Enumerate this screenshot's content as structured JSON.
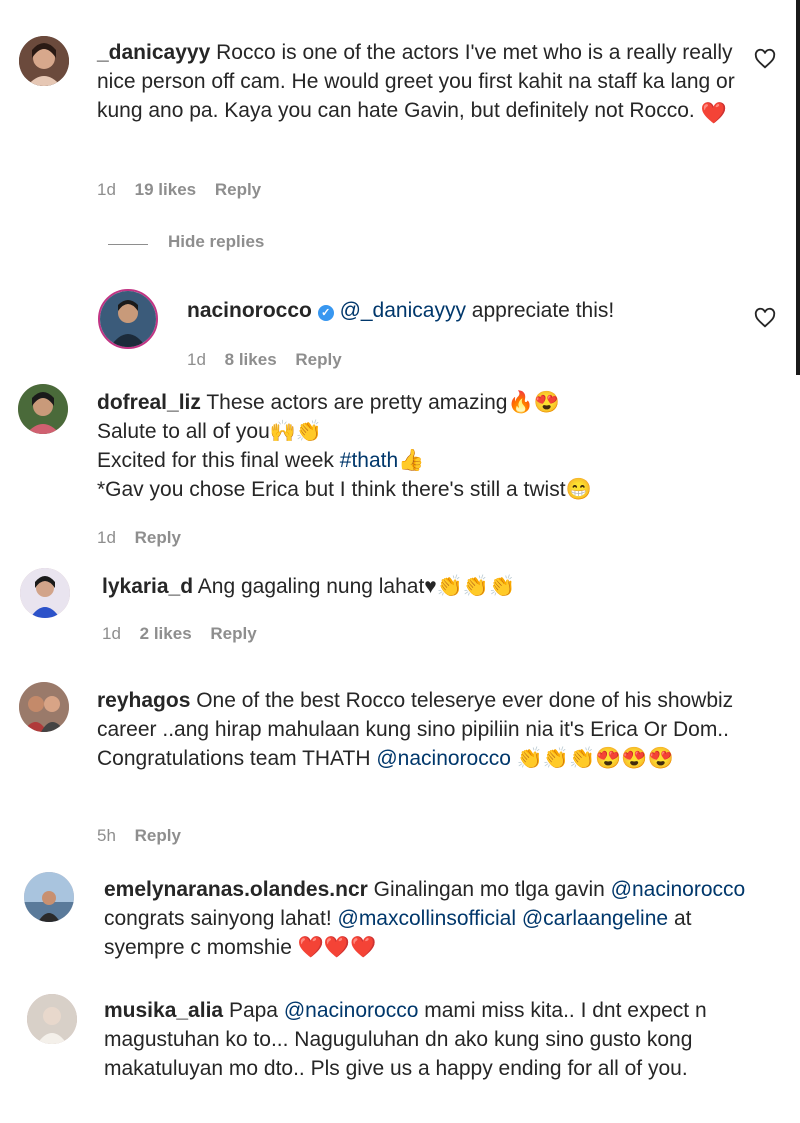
{
  "comments": [
    {
      "username": "_danicayyy",
      "text": "Rocco is one of the actors I've met who is a really really nice person off cam. He would greet you first kahit na staff ka lang or kung ano pa. Kaya you can hate Gavin, but definitely not Rocco.",
      "emoji": "❤️",
      "time": "1d",
      "likes": "19 likes",
      "reply": "Reply"
    },
    {
      "username": "nacinorocco",
      "mention": "@_danicayyy",
      "text": "appreciate this!",
      "time": "1d",
      "likes": "8 likes",
      "reply": "Reply"
    },
    {
      "username": "dofreal_liz",
      "lines": [
        "These actors are pretty amazing🔥😍",
        "Salute to all of you🙌👏",
        "Excited for this final week",
        "*Gav you chose Erica but I think there's still a twist😁"
      ],
      "hashtag": "#thath",
      "hashtag_emoji": "👍",
      "time": "1d",
      "reply": "Reply"
    },
    {
      "username": "lykaria_d",
      "text": "Ang gagaling nung lahat♥👏👏👏",
      "time": "1d",
      "likes": "2 likes",
      "reply": "Reply"
    },
    {
      "username": "reyhagos",
      "text": "One of the best Rocco teleserye ever done of his showbiz career ..ang hirap mahulaan kung sino pipiliin nia it's Erica Or Dom.. Congratulations team THATH",
      "mention": "@nacinorocco",
      "emoji": "👏👏👏😍😍😍",
      "time": "5h",
      "reply": "Reply"
    },
    {
      "username": "emelynaranas.olandes.ncr",
      "text1": "Ginalingan mo tlga gavin",
      "mention1": "@nacinorocco",
      "text2": "congrats sainyong lahat!",
      "mention2": "@maxcollinsofficial",
      "mention3": "@carlaangeline",
      "text3": "at syempre c momshie",
      "emoji": "❤️❤️❤️"
    },
    {
      "username": "musika_alia",
      "text1": "Papa",
      "mention": "@nacinorocco",
      "text2": "mami miss kita.. I dnt expect n magustuhan ko to... Naguguluhan dn ako kung sino gusto kong makatuluyan mo dto.. Pls give us a happy ending for all of you."
    }
  ],
  "hide_replies": "Hide replies",
  "colors": {
    "text": "#262626",
    "meta": "#8e8e8e",
    "mention": "#00376b",
    "verified": "#3897f0",
    "heart_red": "#ed4956"
  }
}
